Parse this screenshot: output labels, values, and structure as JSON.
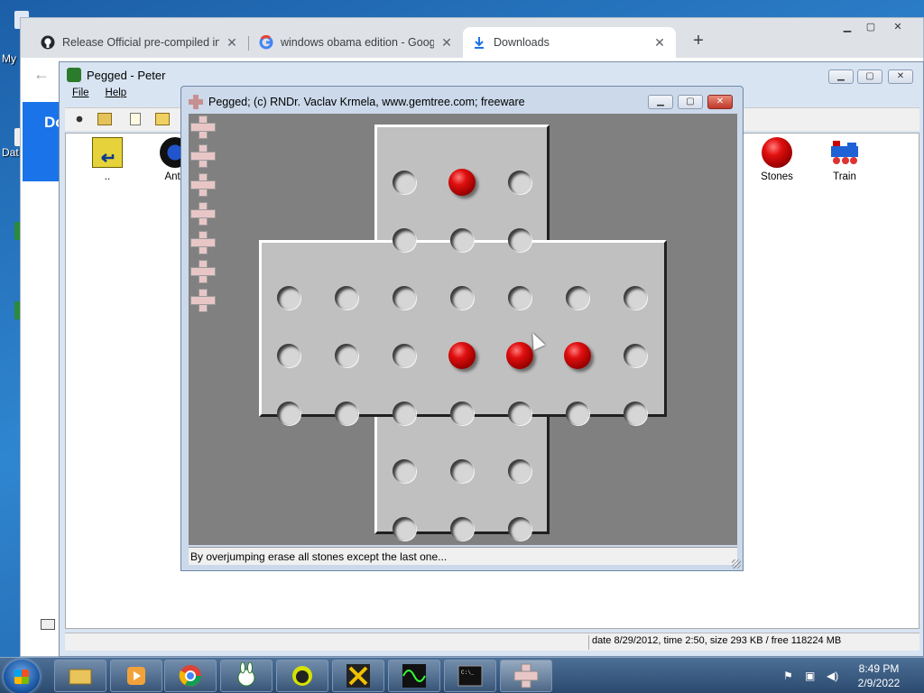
{
  "desktop": {
    "labels": [
      "My",
      "Dat"
    ]
  },
  "chrome": {
    "tabs": [
      {
        "title": "Release Official pre-compiled ins",
        "icon": "github-icon"
      },
      {
        "title": "windows obama edition - Google",
        "icon": "google-icon"
      },
      {
        "title": "Downloads",
        "icon": "download-icon"
      }
    ],
    "close_glyph": "✕",
    "new_tab_glyph": "+",
    "back_glyph": "←",
    "page_heading_partial": "Do"
  },
  "peter_window": {
    "title": "Pegged - Peter",
    "menu": [
      "File",
      "Help"
    ],
    "files": [
      {
        "label": "..",
        "icon": "folder-up-icon"
      },
      {
        "label": "Ants",
        "icon": "ants-icon"
      },
      {
        "label": "Stones",
        "icon": "red-stone-icon"
      },
      {
        "label": "Train",
        "icon": "train-icon"
      }
    ],
    "status": "date 8/29/2012, time 2:50, size 293 KB / free 118224 MB"
  },
  "pegged": {
    "title": "Pegged;   (c) RNDr. Vaclav Krmela, www.gemtree.com;   freeware",
    "status": "By overjumping erase all stones except the last one...",
    "levels": 7,
    "board": [
      [
        null,
        null,
        0,
        1,
        0,
        null,
        null
      ],
      [
        null,
        null,
        0,
        0,
        0,
        null,
        null
      ],
      [
        0,
        0,
        0,
        0,
        0,
        0,
        0
      ],
      [
        0,
        0,
        0,
        1,
        1,
        1,
        0
      ],
      [
        0,
        0,
        0,
        0,
        0,
        0,
        0
      ],
      [
        null,
        null,
        0,
        0,
        0,
        null,
        null
      ],
      [
        null,
        null,
        0,
        0,
        0,
        null,
        null
      ]
    ]
  },
  "taskbar": {
    "apps": [
      "explorer-icon",
      "media-player-icon",
      "chrome-icon",
      "bunny-icon",
      "alien-icon",
      "x-game-icon",
      "oscilloscope-icon",
      "console-icon",
      "pegged-icon"
    ],
    "active_app": "pegged-icon",
    "time": "8:49 PM",
    "date": "2/9/2022"
  },
  "colors": {
    "peg_red": "#d00000",
    "board_gray": "#c0c0c0",
    "background_gray": "#808080",
    "chrome_accent": "#1a73e8"
  }
}
